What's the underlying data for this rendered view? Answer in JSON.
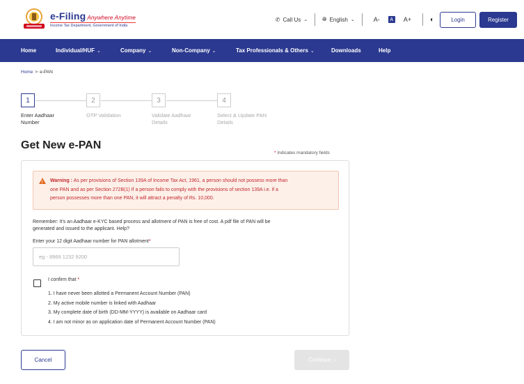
{
  "header": {
    "logo_title": "e-Filing",
    "logo_tagline": "Anywhere Anytime",
    "logo_subtitle": "Income Tax Department, Government of India",
    "call_us": "Call Us",
    "language": "English",
    "font_decrease": "A-",
    "font_normal": "A",
    "font_increase": "A+",
    "login": "Login",
    "register": "Register"
  },
  "nav": {
    "items": [
      {
        "label": "Home"
      },
      {
        "label": "Individual/HUF"
      },
      {
        "label": "Company"
      },
      {
        "label": "Non-Company"
      },
      {
        "label": "Tax Professionals & Others"
      },
      {
        "label": "Downloads"
      },
      {
        "label": "Help"
      }
    ]
  },
  "breadcrumb": {
    "home": "Home",
    "separator": ">",
    "current": "e-PAN"
  },
  "stepper": {
    "steps": [
      {
        "number": "1",
        "label_line1": "Enter Aadhaar",
        "label_line2": "Number"
      },
      {
        "number": "2",
        "label_line1": "OTP Validation",
        "label_line2": ""
      },
      {
        "number": "3",
        "label_line1": "Validate Aadhaar",
        "label_line2": "Details"
      },
      {
        "number": "4",
        "label_line1": "Select & Update PAN",
        "label_line2": "Details"
      }
    ]
  },
  "page": {
    "title": "Get New e-PAN",
    "mandatory_star": "*",
    "mandatory_note": "Indicates mandatory fields"
  },
  "warning": {
    "label": "Warning :",
    "line1": "As per provisions of Section 139A of Income Tax Act, 1961, a person should not possess more than",
    "line2": "one PAN and as per Section 272B(1) If a person fails to comply with the provisions of section 139A i.e. if a",
    "line3": "person possesses more than one PAN, it will attract a penalty of Rs. 10,000."
  },
  "remember": {
    "line1": "Remember: It's an Aadhaar e-KYC based process and allotment of PAN is free of cost. A pdf file of PAN will be",
    "line2": "generated and issued to the applicant. Help?"
  },
  "aadhaar": {
    "label": "Enter your 12 digit Aadhaar number for PAN allotment",
    "star": "*",
    "placeholder": "eg - 8969 1232 9200"
  },
  "confirm": {
    "label": "I confirm that",
    "star": "*",
    "items": [
      "1. I have never been allotted a Permanent Account Number (PAN)",
      "2. My active mobile number is linked with Aadhaar",
      "3. My complete date of birth (DD-MM-YYYY) is available on Aadhaar card",
      "4. I am not minor as on application date of Permanent Account Number (PAN)"
    ]
  },
  "actions": {
    "cancel": "Cancel",
    "continue": "Continue"
  },
  "colors": {
    "brand": "#2b3990",
    "warning_bg": "#fdf0e9",
    "warning_text": "#c1272d",
    "disabled": "#e4e4e4"
  }
}
